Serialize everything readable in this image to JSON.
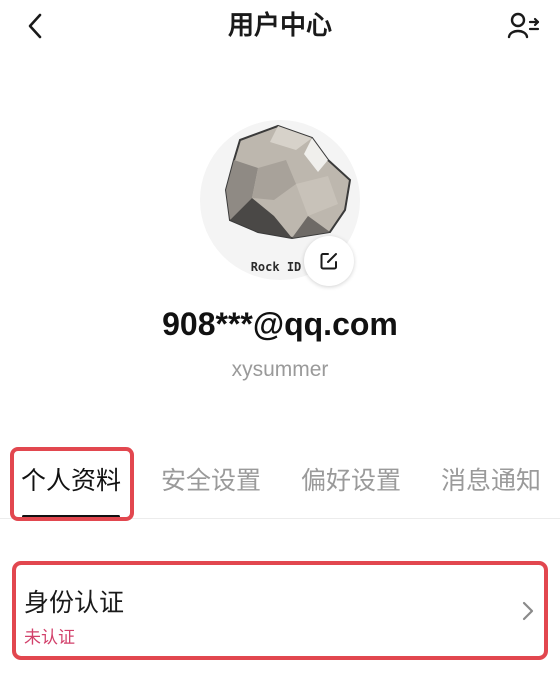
{
  "header": {
    "title": "用户中心",
    "back_icon": "chevron-left-icon",
    "switch_user_icon": "user-switch-icon"
  },
  "profile": {
    "avatar_caption": "Rock ID",
    "edit_icon": "edit-icon",
    "email": "908***@qq.com",
    "username": "xysummer"
  },
  "tabs": [
    {
      "label": "个人资料",
      "active": true
    },
    {
      "label": "安全设置",
      "active": false
    },
    {
      "label": "偏好设置",
      "active": false
    },
    {
      "label": "消息通知",
      "active": false
    }
  ],
  "verification": {
    "title": "身份认证",
    "status": "未认证",
    "status_color": "#d2416b"
  },
  "colors": {
    "highlight": "#e2474f",
    "muted_text": "#9a9a9a"
  }
}
